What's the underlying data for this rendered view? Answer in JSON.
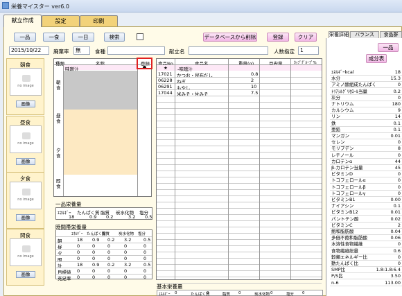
{
  "window": {
    "title": "栄養マイスター ver6.0"
  },
  "tabs": [
    "献立作成",
    "設定",
    "印刷"
  ],
  "toolbar": {
    "ippin": "一品",
    "isshoku": "一食",
    "ichinichi": "一日",
    "search": "検索",
    "db_delete": "データベースから削除",
    "register": "登録",
    "clear": "クリア"
  },
  "filters": {
    "date": "2015/10/22",
    "waste_label": "廃棄率",
    "waste_value": "無",
    "shokushu_label": "食種",
    "menu_name_label": "献立名",
    "people_label": "人数指定",
    "people_value": "1"
  },
  "meals": [
    {
      "label": "朝食",
      "img_text": "no image",
      "btn": "画像"
    },
    {
      "label": "昼食",
      "img_text": "no image",
      "btn": "画像"
    },
    {
      "label": "夕食",
      "img_text": "no image",
      "btn": "画像"
    },
    {
      "label": "間食",
      "img_text": "no image",
      "btn": "画像"
    }
  ],
  "menu_table": {
    "headers": {
      "category": "種類",
      "name": "名称",
      "register": "登録"
    },
    "row1_name": "味噌汁",
    "sections": [
      "朝食",
      "昼食",
      "夕食",
      "間食"
    ]
  },
  "food_table": {
    "headers": {
      "no": "食品No",
      "name": "食品名",
      "weight": "重量(g)",
      "estimate": "目安量",
      "group": "ｶｯﾌﾟｸﾞﾙｰﾌﾟ%"
    },
    "title_row": {
      "mark": "★",
      "name": "-味噌汁"
    },
    "rows": [
      {
        "no": "17021",
        "name": "かつお・昆布だし",
        "weight": "0.8"
      },
      {
        "no": "06228",
        "name": "ねぎ",
        "weight": "2"
      },
      {
        "no": "06291",
        "name": "もやし",
        "weight": "10"
      },
      {
        "no": "17044",
        "name": "米みそ・甘みそ",
        "weight": "7.5"
      }
    ]
  },
  "ippin_nutrition": {
    "title": "一品栄養量",
    "headers": [
      "ｴﾈﾙｷﾞｰ",
      "たんぱく質",
      "脂質",
      "炭水化物",
      "塩分"
    ],
    "values": [
      "18",
      "0.9",
      "0.2",
      "3.2",
      "0.5"
    ]
  },
  "time_nutrition": {
    "title": "時間帯栄養量",
    "headers": [
      "",
      "ｴﾈﾙｷﾞｰ",
      "たんぱく質",
      "脂質",
      "炭水化物",
      "塩分"
    ],
    "rows": [
      [
        "朝",
        "18",
        "0.9",
        "0.2",
        "3.2",
        "0.5"
      ],
      [
        "昼",
        "0",
        "0",
        "0",
        "0",
        "0"
      ],
      [
        "夕",
        "0",
        "0",
        "0",
        "0",
        "0"
      ],
      [
        "間",
        "0",
        "0",
        "0",
        "0",
        "0"
      ],
      [
        "計",
        "18",
        "0.9",
        "0.2",
        "3.2",
        "0.5"
      ],
      [
        "目標値",
        "0",
        "0",
        "0",
        "0",
        "0"
      ],
      [
        "充足率",
        "0",
        "0",
        "0",
        "0",
        "0"
      ]
    ]
  },
  "basic_nutrition": {
    "title": "基本栄養量",
    "items": [
      "ｴﾈﾙｷﾞｰ",
      "0",
      "たんぱく質",
      "0",
      "脂質",
      "0",
      "炭水化物",
      "0",
      "塩分",
      "0"
    ]
  },
  "side": {
    "tabs": [
      "栄養詳細",
      "バランス",
      "食品群"
    ],
    "btn_ippin": "一品",
    "btn_seibun": "成分表",
    "nutrients": [
      [
        "ｴﾈﾙｷﾞｰkcal",
        "18"
      ],
      [
        "水分",
        "15.3"
      ],
      [
        "アミノ酸組成たんぱく",
        "0"
      ],
      [
        "ﾄﾘｱｼﾙｸﾞﾘｾﾛｰﾙ当量",
        "0.2"
      ],
      [
        "灰分",
        "0"
      ],
      [
        "ナトリウム",
        "180"
      ],
      [
        "カルシウム",
        "9"
      ],
      [
        "リン",
        "14"
      ],
      [
        "鉄",
        "0.1"
      ],
      [
        "亜鉛",
        "0.1"
      ],
      [
        "マンガン",
        "0.01"
      ],
      [
        "セレン",
        "0"
      ],
      [
        "モリブデン",
        "8"
      ],
      [
        "レチノール",
        "0"
      ],
      [
        "カロテンα",
        "44"
      ],
      [
        "β-カロテン当量",
        "45"
      ],
      [
        "ビタミンD",
        "0"
      ],
      [
        "トコフェロールα",
        "0"
      ],
      [
        "トコフェロールβ",
        "0"
      ],
      [
        "トコフェロールγ",
        "0"
      ],
      [
        "ビタミンB1",
        "0.00"
      ],
      [
        "ナイアシン",
        "0.1"
      ],
      [
        "ビタミンB12",
        "0.01"
      ],
      [
        "パントテン酸",
        "0.02"
      ],
      [
        "ビタミンC",
        "2"
      ],
      [
        "飽和脂肪酸",
        "0.04"
      ],
      [
        "多価不飽和脂肪酸",
        "0.06"
      ],
      [
        "水溶性食物繊維",
        "0"
      ],
      [
        "食物繊維総量",
        "0.6"
      ],
      [
        "穀類エネルギー比",
        "0"
      ],
      [
        "動たんぱく比",
        "0"
      ],
      [
        "SMP比",
        "1.8:1.8:6.4"
      ],
      [
        "P/S比",
        "3.50"
      ],
      [
        "n-6",
        "113.00"
      ]
    ]
  },
  "accent": {
    "tab": "#f2d27a",
    "highlight_red": "#e02020"
  }
}
